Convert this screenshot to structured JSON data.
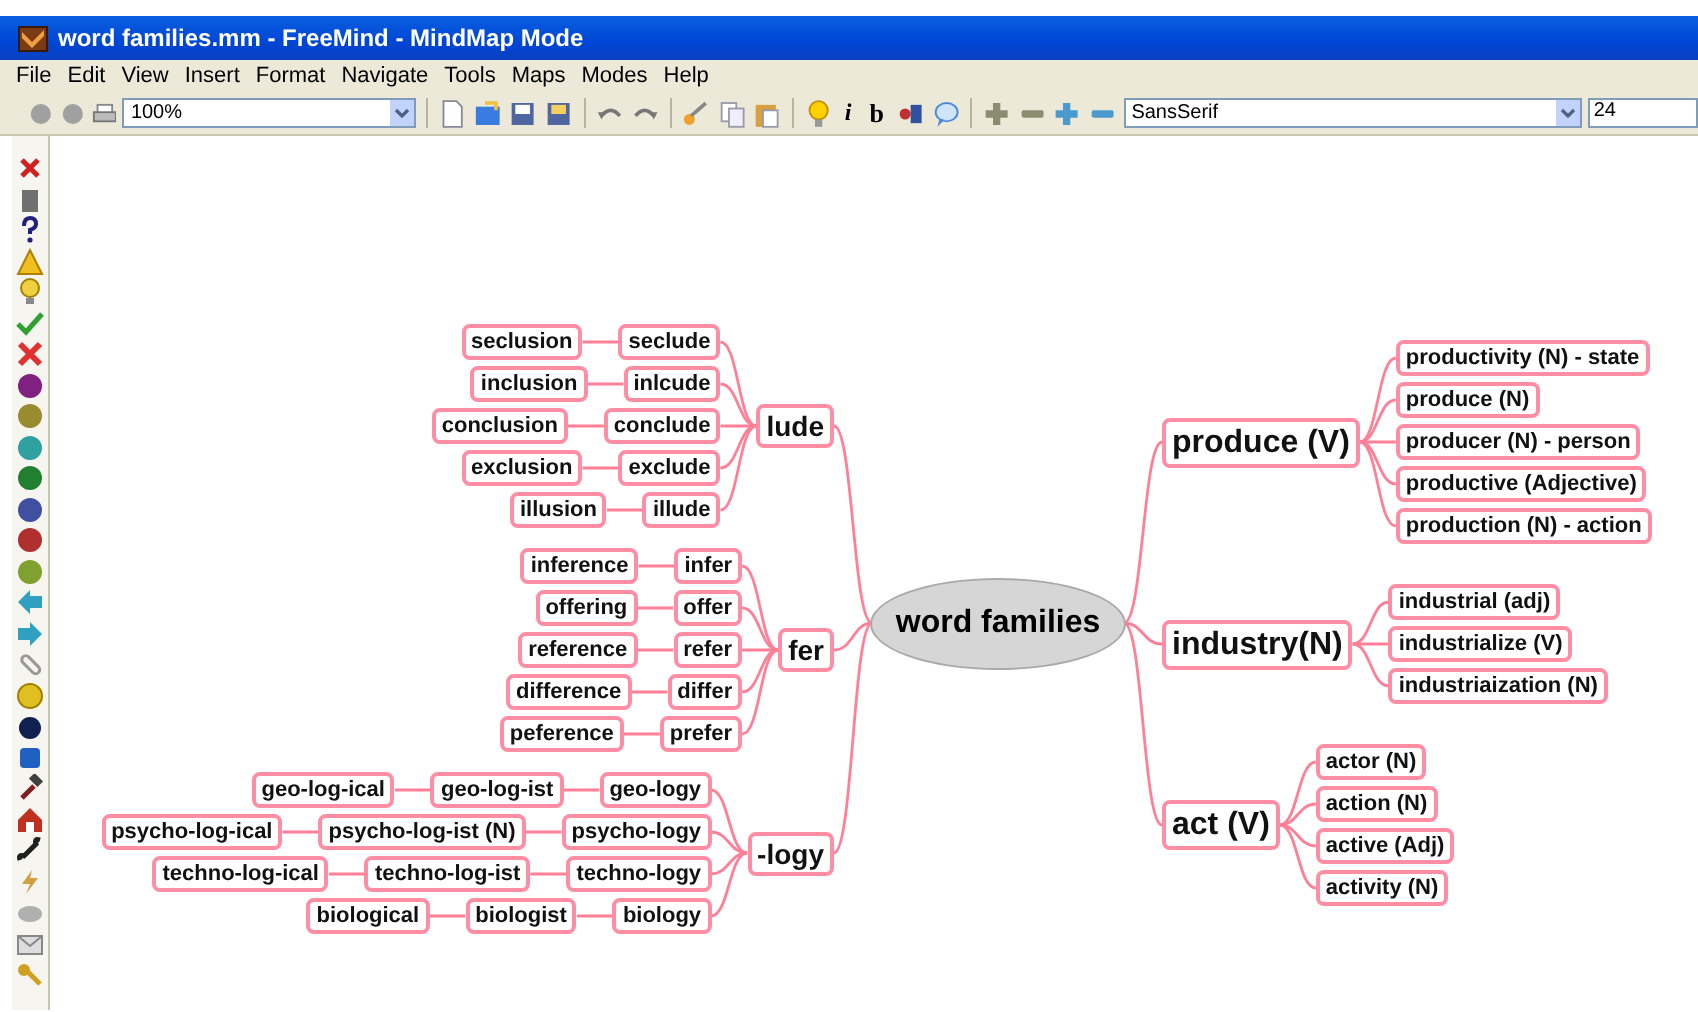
{
  "window": {
    "title": "word families.mm - FreeMind - MindMap Mode"
  },
  "menu": [
    "File",
    "Edit",
    "View",
    "Insert",
    "Format",
    "Navigate",
    "Tools",
    "Maps",
    "Modes",
    "Help"
  ],
  "toolbar": {
    "zoom": "100%",
    "italic_button": "i",
    "bold_button": "b",
    "font": "SansSerif",
    "font_size": "24"
  },
  "map": {
    "root": "word families",
    "left": [
      {
        "text": "lude",
        "children": [
          {
            "text": "seclude",
            "children": [
              {
                "text": "seclusion"
              }
            ]
          },
          {
            "text": "inlcude",
            "children": [
              {
                "text": "inclusion"
              }
            ]
          },
          {
            "text": "conclude",
            "children": [
              {
                "text": "conclusion"
              }
            ]
          },
          {
            "text": "exclude",
            "children": [
              {
                "text": "exclusion"
              }
            ]
          },
          {
            "text": "illude",
            "children": [
              {
                "text": "illusion"
              }
            ]
          }
        ]
      },
      {
        "text": "fer",
        "children": [
          {
            "text": "infer",
            "children": [
              {
                "text": "inference"
              }
            ]
          },
          {
            "text": "offer",
            "children": [
              {
                "text": "offering"
              }
            ]
          },
          {
            "text": "refer",
            "children": [
              {
                "text": "reference"
              }
            ]
          },
          {
            "text": "differ",
            "children": [
              {
                "text": "difference"
              }
            ]
          },
          {
            "text": "prefer",
            "children": [
              {
                "text": "peference"
              }
            ]
          }
        ]
      },
      {
        "text": "-logy",
        "children": [
          {
            "text": "geo-logy",
            "children": [
              {
                "text": "geo-log-ist",
                "children": [
                  {
                    "text": "geo-log-ical"
                  }
                ]
              }
            ]
          },
          {
            "text": "psycho-logy",
            "children": [
              {
                "text": "psycho-log-ist (N)",
                "children": [
                  {
                    "text": "psycho-log-ical"
                  }
                ]
              }
            ]
          },
          {
            "text": "techno-logy",
            "children": [
              {
                "text": "techno-log-ist",
                "children": [
                  {
                    "text": "techno-log-ical"
                  }
                ]
              }
            ]
          },
          {
            "text": "biology",
            "children": [
              {
                "text": "biologist",
                "children": [
                  {
                    "text": "biological"
                  }
                ]
              }
            ]
          }
        ]
      }
    ],
    "right": [
      {
        "text": "produce (V)",
        "children": [
          {
            "text": "productivity (N) - state"
          },
          {
            "text": "produce (N)"
          },
          {
            "text": "producer (N) - person"
          },
          {
            "text": "productive (Adjective)"
          },
          {
            "text": "production (N) - action"
          }
        ]
      },
      {
        "text": "industry(N)",
        "children": [
          {
            "text": "industrial (adj)"
          },
          {
            "text": "industrialize (V)"
          },
          {
            "text": "industriaization (N)"
          }
        ]
      },
      {
        "text": "act (V)",
        "children": [
          {
            "text": "actor (N)"
          },
          {
            "text": "action (N)"
          },
          {
            "text": "active (Adj)"
          },
          {
            "text": "activity (N)"
          }
        ]
      }
    ]
  }
}
